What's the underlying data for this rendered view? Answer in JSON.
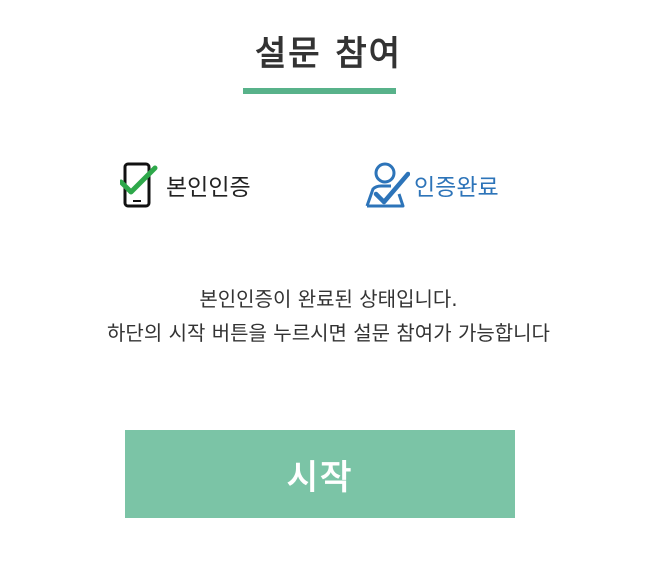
{
  "header": {
    "title": "설문 참여",
    "accent_color": "#58b28a"
  },
  "steps": [
    {
      "label": "본인인증",
      "icon": "phone-check-icon",
      "color": "#222222"
    },
    {
      "label": "인증완료",
      "icon": "user-check-icon",
      "color": "#2d74b9"
    }
  ],
  "message": {
    "line1": "본인인증이 완료된 상태입니다.",
    "line2": "하단의 시작 버튼을 누르시면 설문 참여가 가능합니다"
  },
  "start_button": {
    "label": "시작",
    "color": "#7bc4a6"
  }
}
